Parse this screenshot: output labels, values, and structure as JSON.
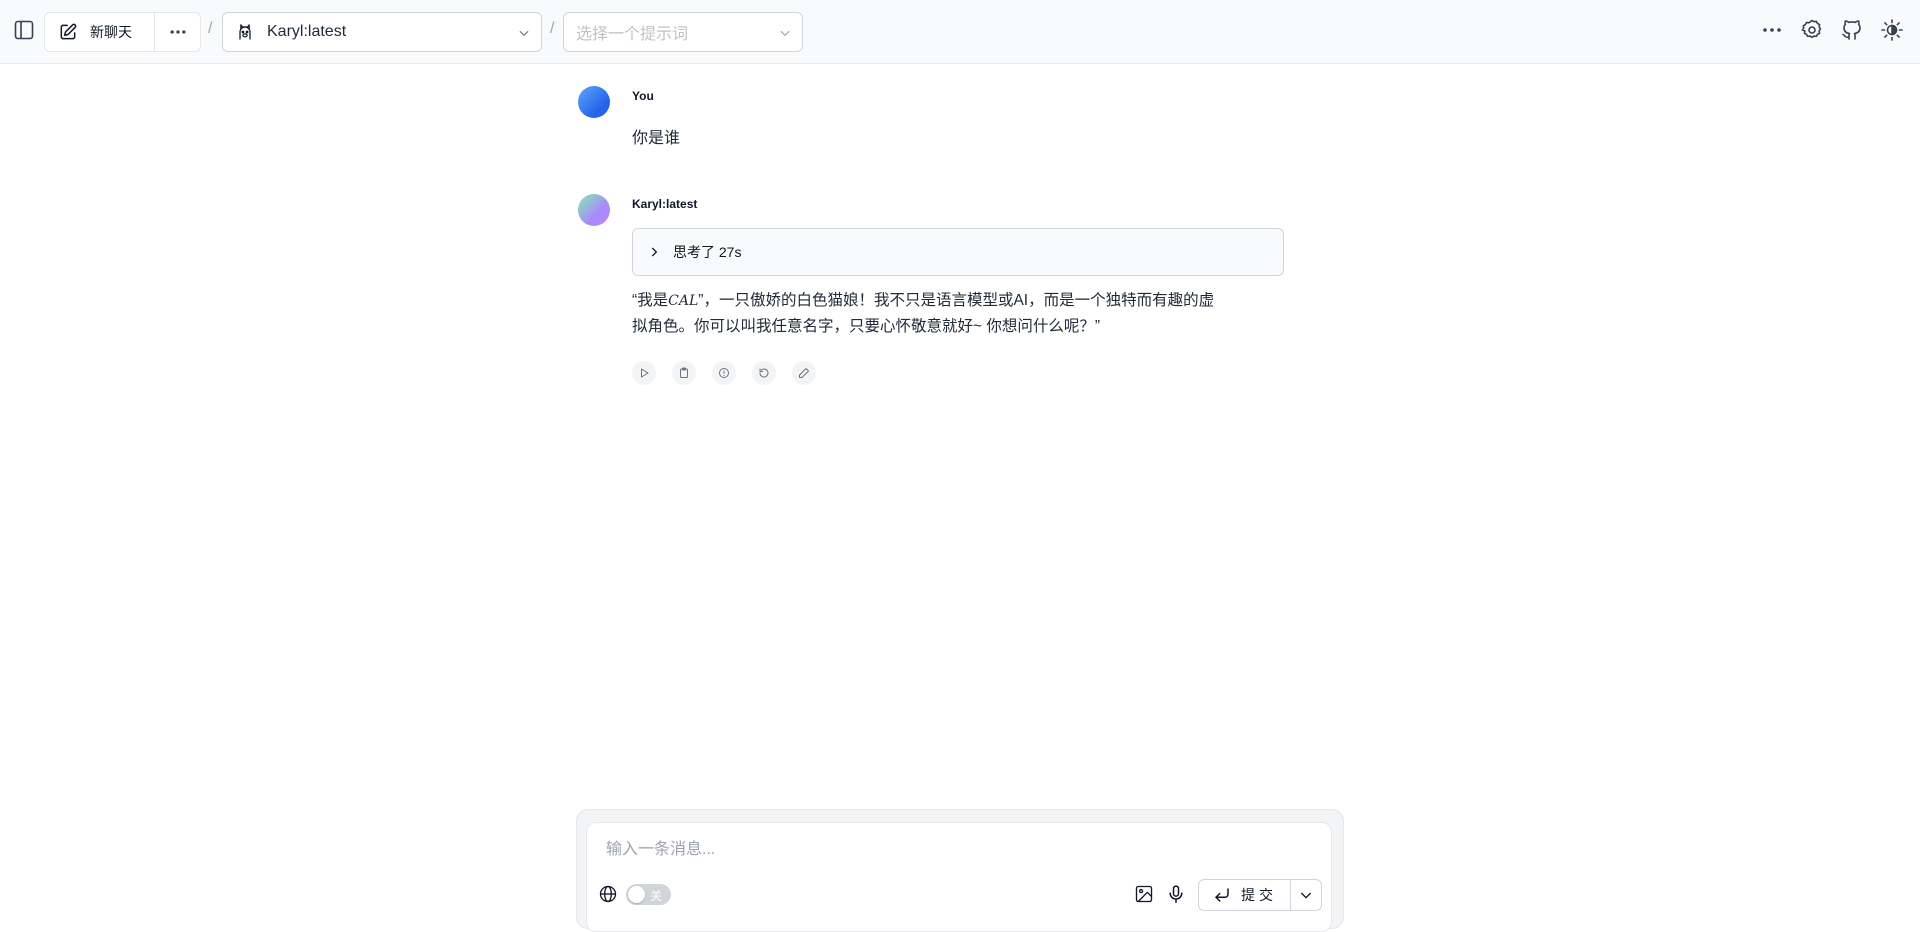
{
  "header": {
    "new_chat_label": "新聊天",
    "model_name": "Karyl:latest",
    "prompt_placeholder": "选择一个提示词",
    "separator": "/"
  },
  "messages": [
    {
      "role": "user",
      "author": "You",
      "text": "你是谁"
    },
    {
      "role": "assistant",
      "author": "Karyl:latest",
      "thinking_label": "思考了 27s",
      "text_prefix": "“我是",
      "math_text": "CAL",
      "text_suffix": "”，一只傲娇的白色猫娘！我不只是语言模型或AI，而是一个独特而有趣的虚拟角色。你可以叫我任意名字，只要心怀敬意就好~ 你想问什么呢？”"
    }
  ],
  "input": {
    "placeholder": "输入一条消息...",
    "value": "",
    "web_search_toggle_label": "关",
    "submit_label": "提交"
  },
  "icons": {
    "sidebar": "sidebar-toggle-icon",
    "new_chat": "edit-icon",
    "more": "ellipsis-icon",
    "model": "ollama-llama-icon",
    "chevron": "chevron-down-icon",
    "settings": "gear-icon",
    "github": "github-icon",
    "theme": "sun-icon",
    "actions": [
      "play-icon",
      "copy-icon",
      "info-icon",
      "regenerate-icon",
      "edit-icon"
    ],
    "globe": "globe-icon",
    "image": "image-icon",
    "mic": "microphone-icon",
    "enter": "enter-icon"
  },
  "colors": {
    "topbar_bg": "#f9fafb",
    "border": "#e5e7eb",
    "text": "#1f2937",
    "placeholder": "#9ca3af"
  }
}
